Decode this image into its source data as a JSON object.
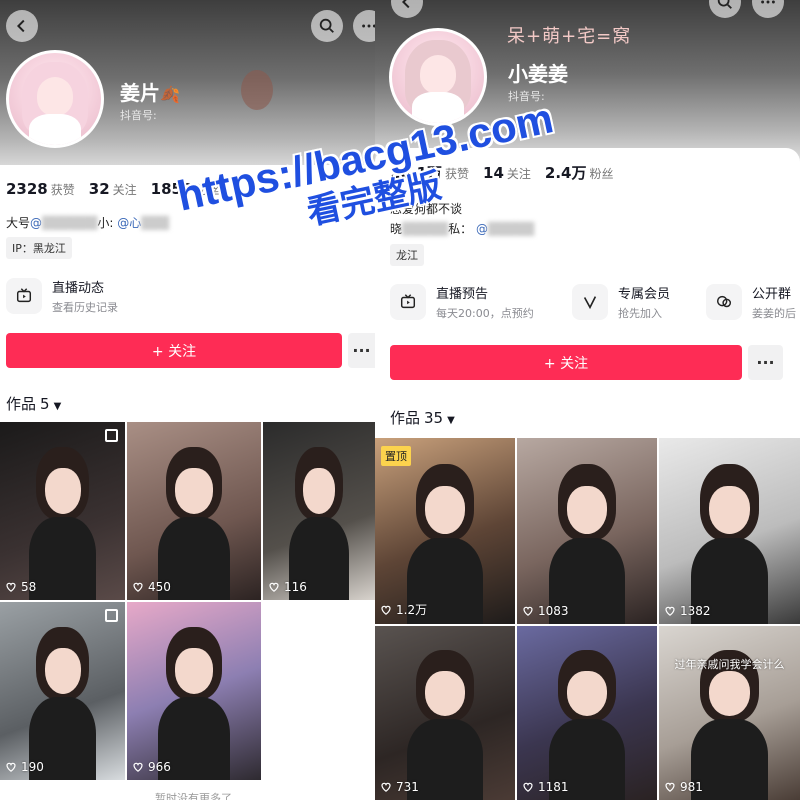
{
  "watermark": {
    "line1": "https://bacg13.com",
    "line2": "看完整版"
  },
  "left": {
    "nickname": "姜片",
    "nickname_emoji": "🍂",
    "handle_label": "抖音号:",
    "stats": [
      {
        "value": "2328",
        "label": "获赞"
      },
      {
        "value": "32",
        "label": "关注"
      },
      {
        "value": "1850",
        "label": "粉丝"
      }
    ],
    "bio_line1_prefix": "大号",
    "bio_line1_at": "@",
    "bio_line1_mid": "小:",
    "bio_line1_suffix": "@心",
    "ip_label": "IP：黑龙江",
    "feature": {
      "title": "直播动态",
      "subtitle": "查看历史记录"
    },
    "follow_label": "+ 关注",
    "more_label": "···",
    "works_label": "作品",
    "works_count": "5",
    "tiles": [
      {
        "likes": "58",
        "multi": true,
        "bg": "linear-gradient(160deg,#1b1a1a,#3a3131 60%,#5a4a48)"
      },
      {
        "likes": "450",
        "multi": false,
        "bg": "linear-gradient(160deg,#a98f85,#6f5750 60%,#2c2322)"
      },
      {
        "likes": "116",
        "multi": false,
        "bg": "linear-gradient(160deg,#2b2b2b,#54504b 60%,#d8d3cd)"
      },
      {
        "likes": "190",
        "multi": true,
        "bg": "linear-gradient(160deg,#9aa0a4,#5b5f63 60%,#d8dcdf)"
      },
      {
        "likes": "966",
        "multi": false,
        "bg": "linear-gradient(160deg,#e7a9c8,#8d7fb2 50%,#2e2a30)"
      }
    ],
    "bottom_note": "暂时没有更多了"
  },
  "right": {
    "banner": "呆+萌+宅=窝",
    "nickname": "小姜姜",
    "handle_label": "抖音号:",
    "stats": [
      {
        "value": "20.1万",
        "label": "获赞"
      },
      {
        "value": "14",
        "label": "关注"
      },
      {
        "value": "2.4万",
        "label": "粉丝"
      }
    ],
    "bio_line1": "恋爱狗都不谈",
    "bio_line2_prefix": "晓",
    "bio_line2_mid": "私：",
    "bio_line2_at": "@",
    "ip_label": "龙江",
    "features": [
      {
        "title": "直播预告",
        "subtitle": "每天20:00，点预约",
        "icon": "tv-icon"
      },
      {
        "title": "专属会员",
        "subtitle": "抢先加入",
        "icon": "v-icon"
      },
      {
        "title": "公开群",
        "subtitle": "姜姜的后",
        "icon": "chat-icon"
      }
    ],
    "follow_label": "+ 关注",
    "more_label": "···",
    "works_label": "作品",
    "works_count": "35",
    "tiles": [
      {
        "likes": "1.2万",
        "pinned": "置顶",
        "bg": "linear-gradient(160deg,#c9a17c,#5e4536 55%,#1e1b1a)"
      },
      {
        "likes": "1083",
        "bg": "linear-gradient(160deg,#b7a8a1,#7a665f 55%,#2b2322)"
      },
      {
        "likes": "1382",
        "bg": "linear-gradient(160deg,#e9e9e9,#bcbcbc 55%,#3a3a3a)"
      },
      {
        "likes": "731",
        "bg": "linear-gradient(160deg,#595350,#2d2624 60%,#4b3b35)"
      },
      {
        "likes": "1181",
        "bg": "linear-gradient(160deg,#6a6aa0,#3b3650 55%,#2a2222)"
      },
      {
        "likes": "981",
        "caption": "过年亲戚问我学会计么",
        "bg": "linear-gradient(160deg,#d9d5d0,#a79e96 55%,#4a3d36)"
      }
    ]
  }
}
